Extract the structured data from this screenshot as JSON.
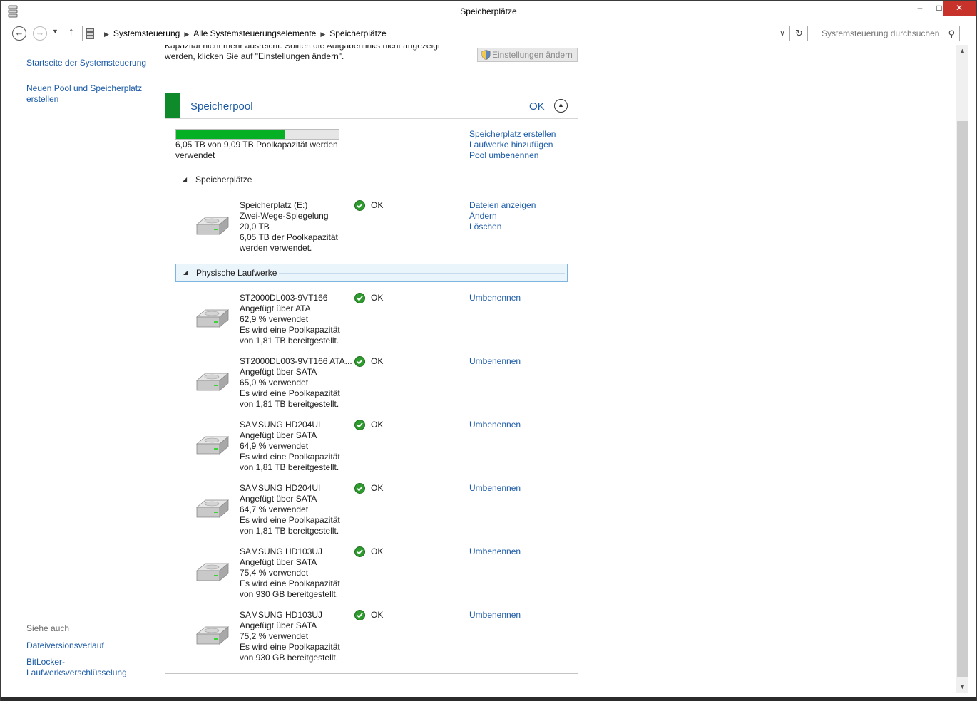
{
  "window": {
    "title": "Speicherplätze",
    "controls": {
      "minimize": "–",
      "maximize": "□",
      "close": "✕"
    }
  },
  "address": {
    "crumbs": [
      "Systemsteuerung",
      "Alle Systemsteuerungselemente",
      "Speicherplätze"
    ],
    "search_placeholder": "Systemsteuerung durchsuchen"
  },
  "sidebar": {
    "home": "Startseite der Systemsteuerung",
    "new_pool": "Neuen Pool und Speicherplatz erstellen",
    "see_also": "Siehe auch",
    "file_history": "Dateiversionsverlauf",
    "bitlocker": "BitLocker-Laufwerksverschlüsselung"
  },
  "top_note": {
    "text": "Kapazität nicht mehr ausreicht. Sollten die Aufgabenlinks nicht angezeigt werden, klicken Sie auf \"Einstellungen ändern\".",
    "button": "Einstellungen ändern"
  },
  "pool": {
    "title": "Speicherpool",
    "status": "OK",
    "usage_fraction": 0.665,
    "usage_text": "6,05 TB von 9,09 TB Poolkapazität werden verwendet",
    "links": [
      "Speicherplatz erstellen",
      "Laufwerke hinzufügen",
      "Pool umbenennen"
    ],
    "spaces_header": "Speicherplätze",
    "space": {
      "lines": [
        "Speicherplatz (E:)",
        "Zwei-Wege-Spiegelung",
        "20,0 TB",
        "6,05 TB der Poolkapazität",
        "werden verwendet."
      ],
      "status": "OK",
      "actions": [
        "Dateien anzeigen",
        "Ändern",
        "Löschen"
      ]
    },
    "drives_header": "Physische Laufwerke",
    "drives": [
      {
        "lines": [
          "ST2000DL003-9VT166",
          "Angefügt über ATA",
          "62,9 % verwendet",
          "Es wird eine Poolkapazität",
          "von 1,81 TB bereitgestellt."
        ],
        "status": "OK",
        "action": "Umbenennen"
      },
      {
        "lines": [
          "ST2000DL003-9VT166 ATA...",
          "Angefügt über SATA",
          "65,0 % verwendet",
          "Es wird eine Poolkapazität",
          "von 1,81 TB bereitgestellt."
        ],
        "status": "OK",
        "action": "Umbenennen"
      },
      {
        "lines": [
          "SAMSUNG HD204UI",
          "Angefügt über SATA",
          "64,9 % verwendet",
          "Es wird eine Poolkapazität",
          "von 1,81 TB bereitgestellt."
        ],
        "status": "OK",
        "action": "Umbenennen"
      },
      {
        "lines": [
          "SAMSUNG HD204UI",
          "Angefügt über SATA",
          "64,7 % verwendet",
          "Es wird eine Poolkapazität",
          "von 1,81 TB bereitgestellt."
        ],
        "status": "OK",
        "action": "Umbenennen"
      },
      {
        "lines": [
          "SAMSUNG HD103UJ",
          "Angefügt über SATA",
          "75,4 % verwendet",
          "Es wird eine Poolkapazität",
          "von 930 GB bereitgestellt."
        ],
        "status": "OK",
        "action": "Umbenennen"
      },
      {
        "lines": [
          "SAMSUNG HD103UJ",
          "Angefügt über SATA",
          "75,2 % verwendet",
          "Es wird eine Poolkapazität",
          "von 930 GB bereitgestellt."
        ],
        "status": "OK",
        "action": "Umbenennen"
      }
    ]
  },
  "colors": {
    "link": "#1a5aa6",
    "progress": "#06b025",
    "pool_accent": "#0e8a2a",
    "close": "#c7322a"
  }
}
